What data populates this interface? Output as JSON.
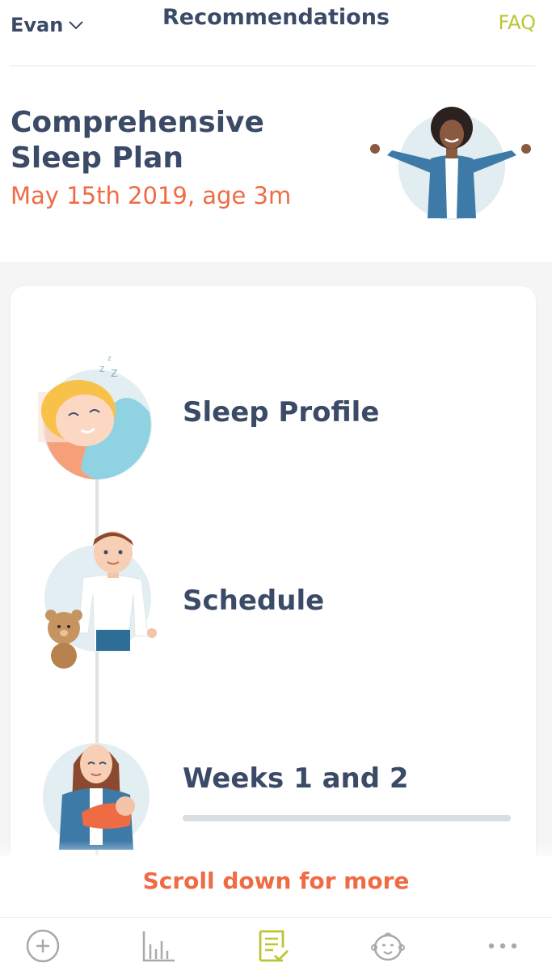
{
  "header": {
    "child_name": "Evan",
    "title": "Recommendations",
    "faq_label": "FAQ"
  },
  "plan": {
    "title": "Comprehensive Sleep Plan",
    "date_line": "May 15th 2019, age 3m"
  },
  "steps": [
    {
      "label": "Sleep Profile",
      "icon": "sleeping-baby-icon"
    },
    {
      "label": "Schedule",
      "icon": "dad-with-teddy-icon"
    },
    {
      "label": "Weeks 1 and 2",
      "icon": "mom-holding-baby-icon",
      "progress": 0.0
    }
  ],
  "scroll_hint": "Scroll down for more",
  "nav": {
    "items": [
      {
        "icon": "add-circle-icon"
      },
      {
        "icon": "bar-chart-icon"
      },
      {
        "icon": "plan-checklist-icon",
        "active": true
      },
      {
        "icon": "baby-face-icon"
      },
      {
        "icon": "more-dots-icon"
      }
    ]
  },
  "colors": {
    "accent_orange": "#ef6b44",
    "accent_lime": "#b6c832",
    "text_navy": "#3b4a66",
    "light_blue": "#8fd3e3"
  }
}
